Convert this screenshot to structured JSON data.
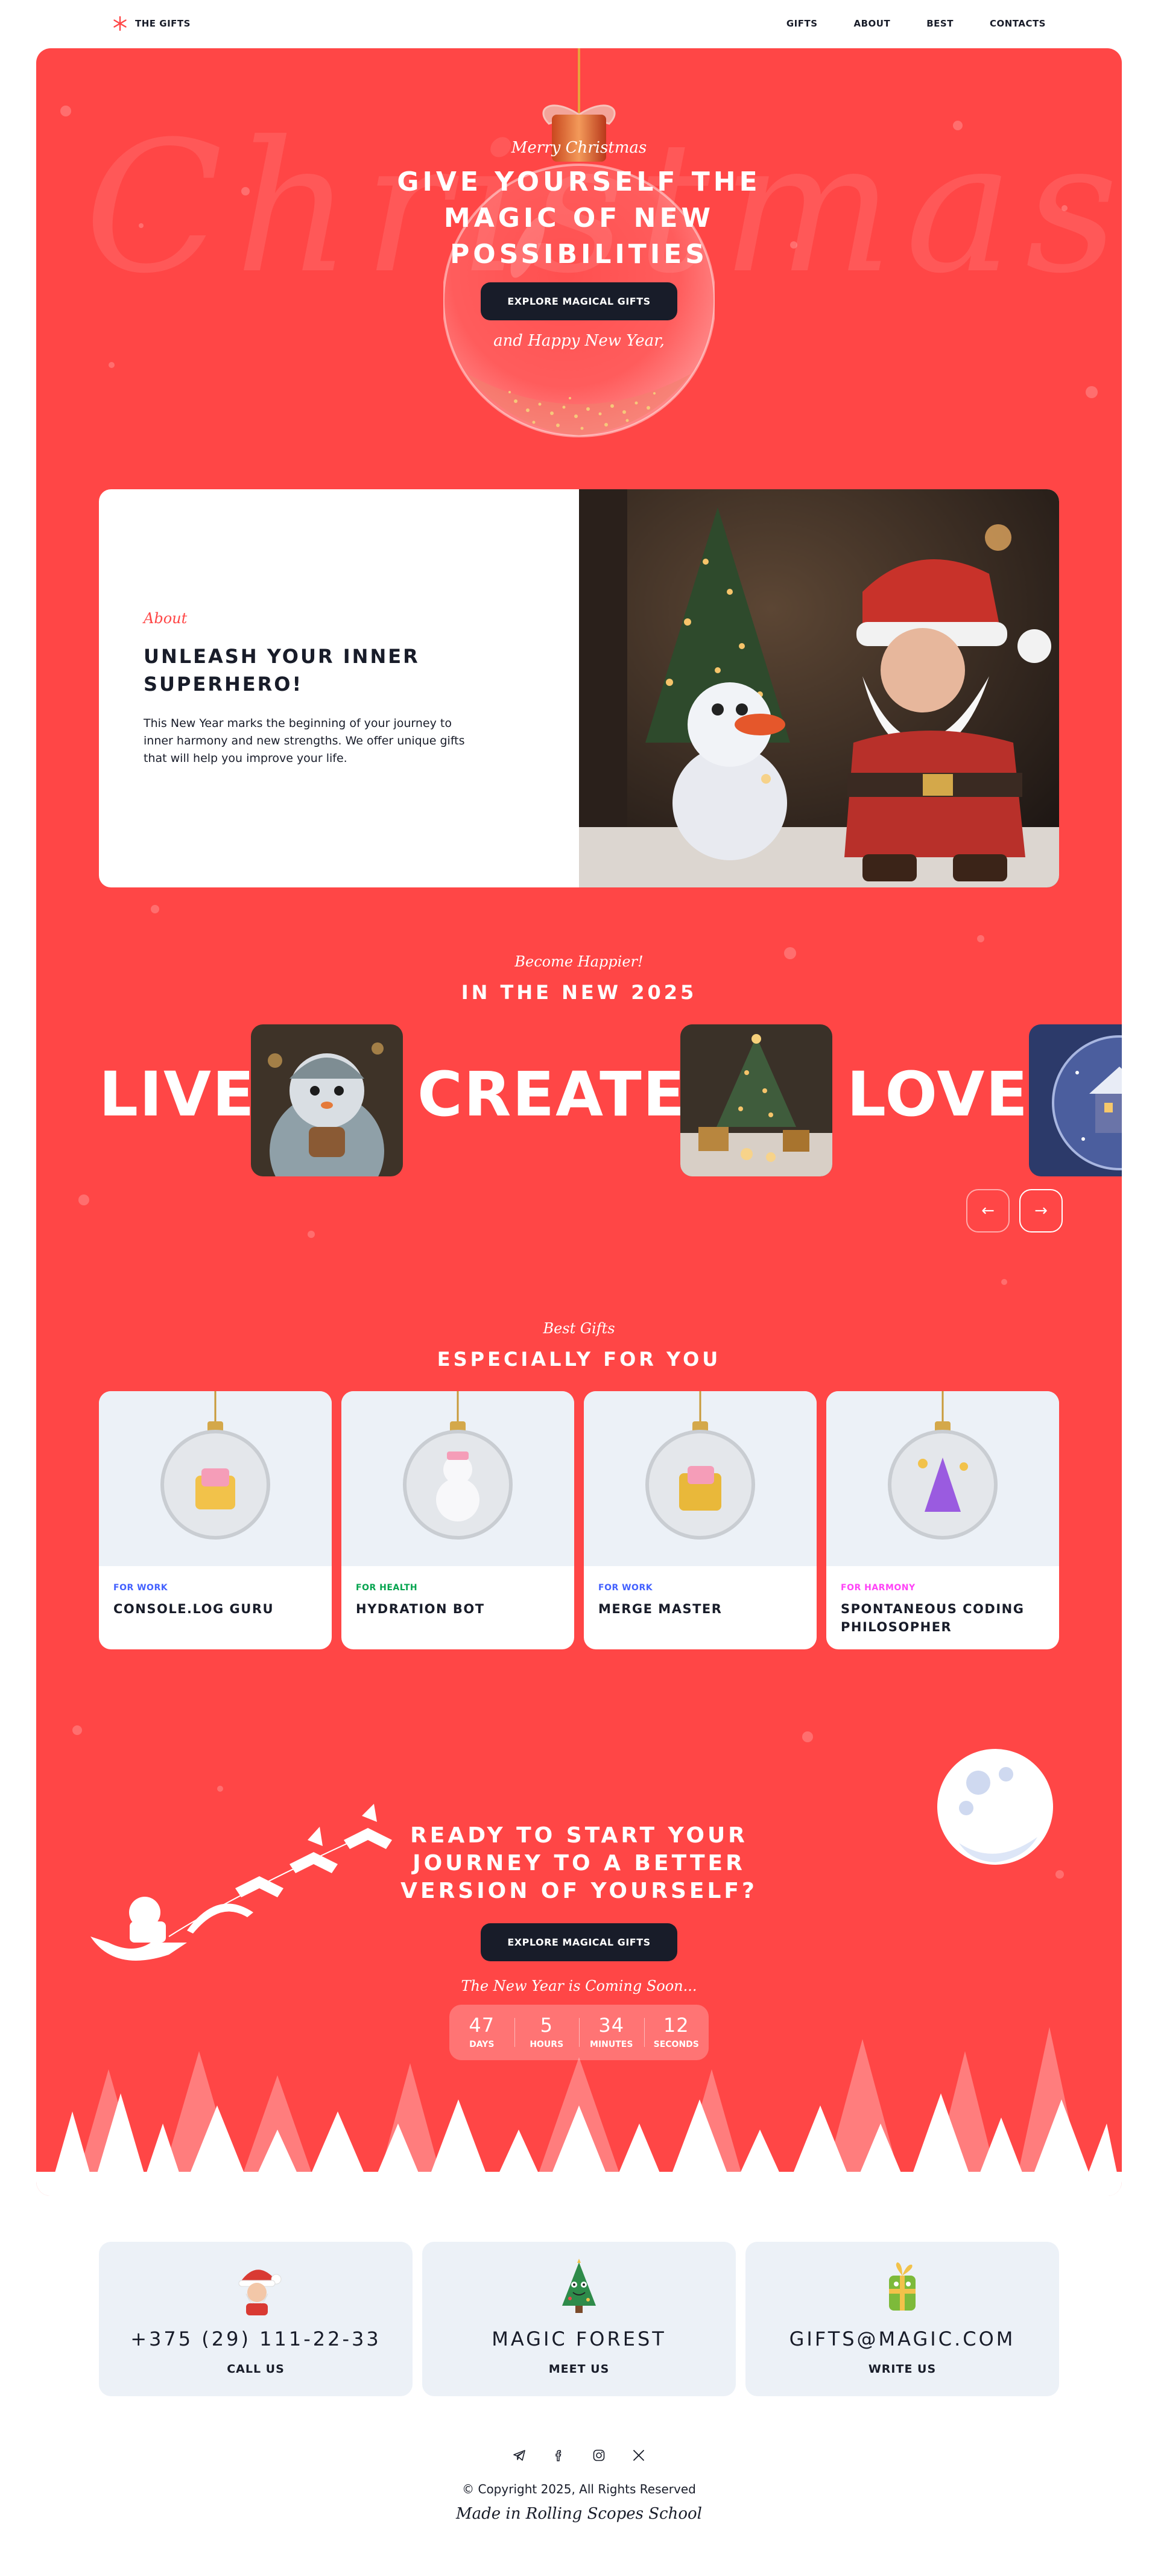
{
  "header": {
    "logo_text": "THE GIFTS",
    "nav": [
      "GIFTS",
      "ABOUT",
      "BEST",
      "CONTACTS"
    ]
  },
  "hero": {
    "bg_word": "Christmas",
    "top_script": "Merry Christmas",
    "title": "GIVE YOURSELF THE MAGIC OF NEW POSSIBILITIES",
    "button": "EXPLORE MAGICAL GIFTS",
    "bottom_script": "and Happy New Year,"
  },
  "about": {
    "label": "About",
    "title": "UNLEASH YOUR INNER SUPERHERO!",
    "text": "This New Year marks the beginning of your journey to inner harmony and new strengths. We offer unique gifts that will help you improve your life."
  },
  "slider": {
    "script": "Become Happier!",
    "title": "IN THE NEW 2025",
    "words": [
      "LIVE",
      "CREATE",
      "LOVE"
    ]
  },
  "gifts": {
    "script": "Best Gifts",
    "title": "ESPECIALLY FOR YOU",
    "items": [
      {
        "category": "FOR WORK",
        "name": "CONSOLE.LOG GURU",
        "color": "#4361FF"
      },
      {
        "category": "FOR HEALTH",
        "name": "HYDRATION BOT",
        "color": "#06A44F"
      },
      {
        "category": "FOR WORK",
        "name": "MERGE MASTER",
        "color": "#4361FF"
      },
      {
        "category": "FOR HARMONY",
        "name": "SPONTANEOUS CODING PHILOSOPHER",
        "color": "#FF43F7"
      }
    ]
  },
  "cta": {
    "title": "READY TO START YOUR JOURNEY TO A BETTER VERSION OF YOURSELF?",
    "button": "EXPLORE MAGICAL GIFTS",
    "script": "The New Year is Coming Soon...",
    "timer": [
      {
        "value": "47",
        "label": "DAYS"
      },
      {
        "value": "5",
        "label": "HOURS"
      },
      {
        "value": "34",
        "label": "MINUTES"
      },
      {
        "value": "12",
        "label": "SECONDS"
      }
    ]
  },
  "contacts": [
    {
      "value": "+375 (29) 111-22-33",
      "label": "CALL US"
    },
    {
      "value": "MAGIC FOREST",
      "label": "MEET US"
    },
    {
      "value": "GIFTS@MAGIC.COM",
      "label": "WRITE US"
    }
  ],
  "footer": {
    "socials": [
      "telegram-icon",
      "facebook-icon",
      "instagram-icon",
      "x-icon"
    ],
    "copyright": "© Copyright 2025, All Rights Reserved",
    "made": "Made in Rolling Scopes School"
  },
  "colors": {
    "accent": "#FF4646",
    "dark": "#181C29",
    "light": "#ECF1F7"
  }
}
